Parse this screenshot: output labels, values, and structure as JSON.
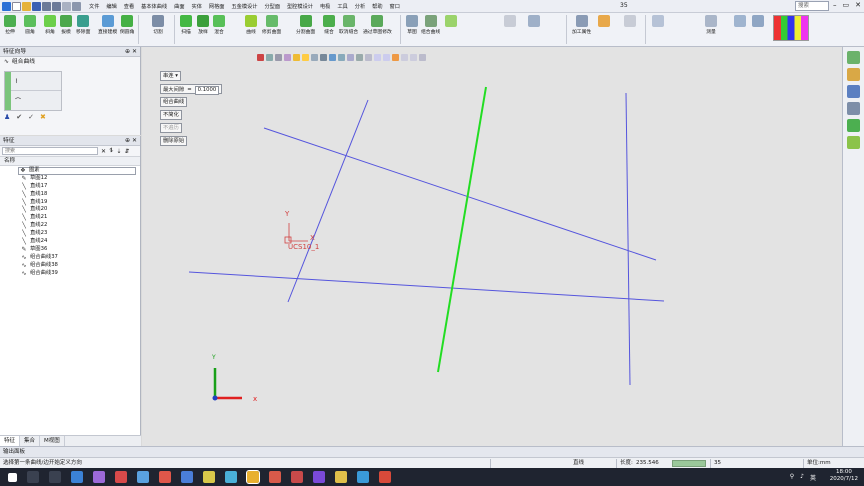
{
  "window": {
    "title": "35",
    "search_placeholder": "搜索"
  },
  "menu": [
    "文件",
    "编辑",
    "查看",
    "基本体曲线",
    "曲面",
    "实体",
    "网格面",
    "五金模设计",
    "分型面",
    "型腔模设计",
    "电极",
    "工具",
    "分析",
    "帮助",
    "窗口"
  ],
  "ribbon": {
    "buttons": [
      "拉伸",
      "圆角",
      "斜角",
      "拔模",
      "移除面",
      "直接建模",
      "倒圆角",
      "切割",
      "扫描",
      "放样",
      "混合",
      "曲线",
      "修剪曲面",
      "分割曲面",
      "缝合",
      "取消缝合",
      "通过草图修改",
      "草图",
      "组合曲线",
      "加工属性",
      "测量"
    ]
  },
  "wizard": {
    "header": "特征向导",
    "title": "组合曲线"
  },
  "feature_panel": {
    "header": "特征",
    "search_placeholder": "搜索",
    "column_name": "名称",
    "items": [
      {
        "label": "图素",
        "icon": "layers-icon"
      },
      {
        "label": "草图12",
        "icon": "sketch-icon"
      },
      {
        "label": "直线17",
        "icon": "line-icon"
      },
      {
        "label": "直线18",
        "icon": "line-icon"
      },
      {
        "label": "直线19",
        "icon": "line-icon"
      },
      {
        "label": "直线20",
        "icon": "line-icon"
      },
      {
        "label": "直线21",
        "icon": "line-icon"
      },
      {
        "label": "直线22",
        "icon": "line-icon"
      },
      {
        "label": "直线23",
        "icon": "line-icon"
      },
      {
        "label": "直线24",
        "icon": "line-icon"
      },
      {
        "label": "草图36",
        "icon": "sketch-icon"
      },
      {
        "label": "组合曲线37",
        "icon": "curve-icon"
      },
      {
        "label": "组合曲线38",
        "icon": "curve-icon"
      },
      {
        "label": "组合曲线39",
        "icon": "curve-icon"
      }
    ],
    "tabs": [
      "特征",
      "集合",
      "M视图"
    ]
  },
  "command_panel": {
    "dropdown": "串连",
    "max_gap_label": "最大间隙",
    "max_gap_value": "0.1000",
    "btn_combine": "组合曲线",
    "btn_simplify": "不简化",
    "btn_notsmooth": "不遍历",
    "btn_delete_orig": "删除原始"
  },
  "viewport": {
    "ucs_label": "UCS10_1",
    "axis_y": "Y",
    "axis_x": "X",
    "triad_y": "Y",
    "triad_x": "x"
  },
  "output_panel": {
    "header": "输出面板"
  },
  "status": {
    "prompt": "选择第一条曲线/边开始定义方向",
    "entity": "直线",
    "length_label": "长度:",
    "length_value": "235.546",
    "file": "35",
    "unit": "单位:mm"
  },
  "taskbar": {
    "time": "18:00",
    "date": "2020/7/12",
    "lang": "英"
  },
  "colors": {
    "selected_line": "#22dd22",
    "curve_line": "#5555dd",
    "ucs": "#d04040",
    "accent": "#2a6fd6"
  }
}
